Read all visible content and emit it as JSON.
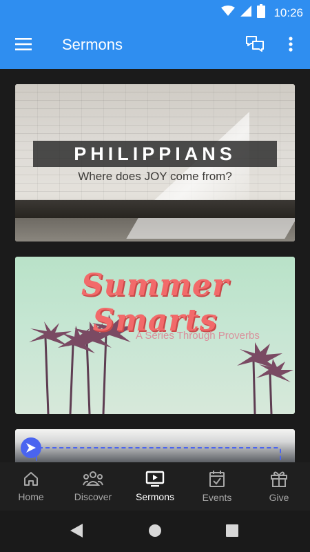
{
  "status_bar": {
    "time": "10:26",
    "icons": [
      "wifi-icon",
      "signal-icon",
      "battery-icon"
    ]
  },
  "app_bar": {
    "title": "Sermons",
    "icons": [
      "menu-icon",
      "chat-icon",
      "more-vert-icon"
    ],
    "color": "#2f8ef0"
  },
  "sermons": [
    {
      "title": "PHILIPPIANS",
      "subtitle": "Where does JOY come from?"
    },
    {
      "title": "Summer Smarts",
      "subtitle": "A Series Through Proverbs"
    },
    {
      "title": "",
      "subtitle": ""
    }
  ],
  "bottom_nav": {
    "items": [
      {
        "label": "Home",
        "icon": "home-icon",
        "active": false
      },
      {
        "label": "Discover",
        "icon": "people-icon",
        "active": false
      },
      {
        "label": "Sermons",
        "icon": "video-icon",
        "active": true
      },
      {
        "label": "Events",
        "icon": "calendar-icon",
        "active": false
      },
      {
        "label": "Give",
        "icon": "gift-icon",
        "active": false
      }
    ]
  },
  "system_nav": {
    "icons": [
      "back-icon",
      "home-circle-icon",
      "recents-icon"
    ]
  }
}
